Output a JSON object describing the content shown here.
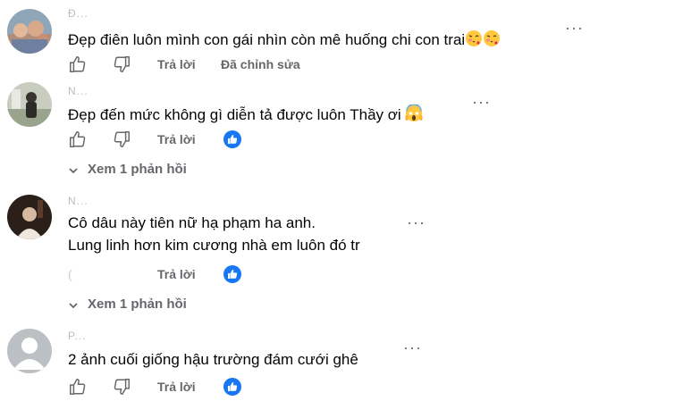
{
  "colors": {
    "like_blue": "#1877f2",
    "muted": "#65676b",
    "text": "#050505"
  },
  "comments": [
    {
      "author": "Đ...",
      "lines": [
        "Đẹp điên luôn mình con gái nhìn còn mê huống chi con trai"
      ],
      "emojis": [
        "face-blowing-kiss-icon",
        "face-blowing-kiss-icon"
      ],
      "more": "···",
      "reply": "Trả lời",
      "edited": "Đã chỉnh sửa",
      "has_reaction": false
    },
    {
      "author": "N...",
      "lines": [
        "Đẹp đến mức không gì diễn tả được luôn Thầy ơi"
      ],
      "emojis": [
        "screaming-face-icon"
      ],
      "more": "···",
      "reply": "Trả lời",
      "has_reaction": true,
      "view_replies": "Xem 1 phản hồi"
    },
    {
      "author": "N...",
      "lines": [
        "Cô dâu này tiên nữ hạ phạm ha anh.",
        "Lung linh hơn kim cương nhà em luôn đó tr"
      ],
      "more": "···",
      "reply": "Trả lời",
      "has_reaction": true,
      "view_replies": "Xem 1 phản hồi"
    },
    {
      "author": "P...",
      "lines": [
        "2 ảnh cuối giống hậu trường đám cưới ghê"
      ],
      "more": "···",
      "reply": "Trả lời",
      "has_reaction": true
    }
  ]
}
